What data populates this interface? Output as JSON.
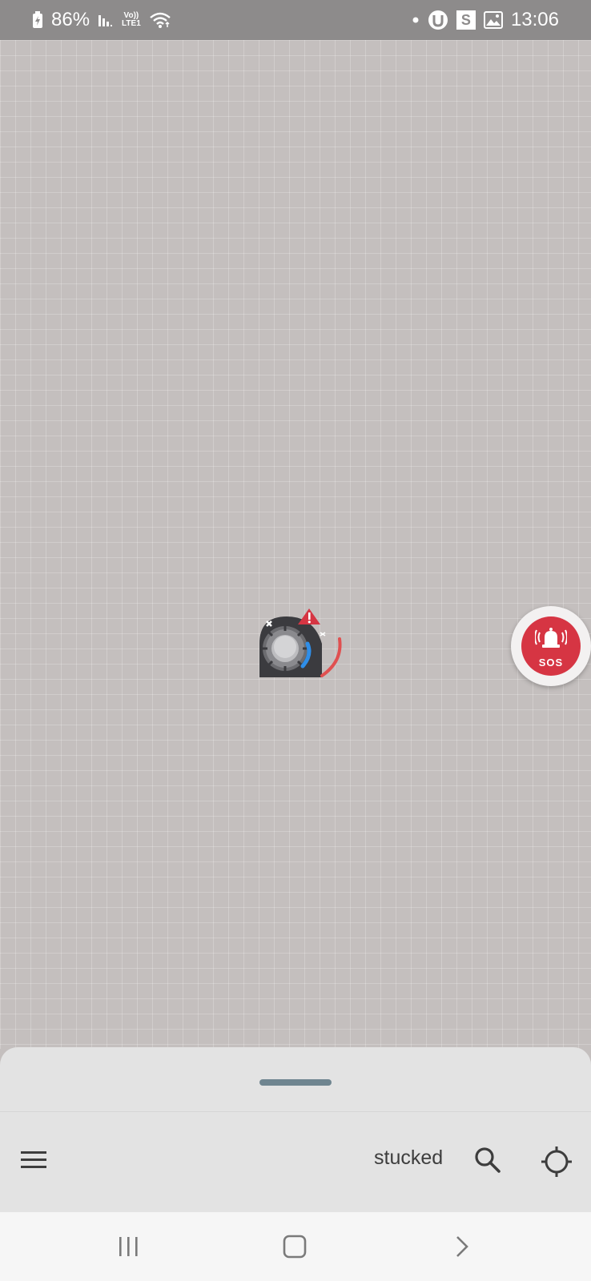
{
  "status_bar": {
    "battery_percent": "86%",
    "network_label_top": "Vo))",
    "network_label_bottom": "LTE1",
    "time": "13:06"
  },
  "map": {
    "robot_state": "stuck-warning",
    "sos_label": "SOS"
  },
  "bottom_sheet": {
    "status_text": "stucked"
  },
  "colors": {
    "sos_red": "#d63543",
    "handle": "#6f8590",
    "progress_blue": "#2f8ee8",
    "progress_red": "#e05050"
  },
  "icons": {
    "menu": "hamburger-icon",
    "search": "search-icon",
    "locate": "crosshair-icon",
    "sos": "bell-icon"
  }
}
